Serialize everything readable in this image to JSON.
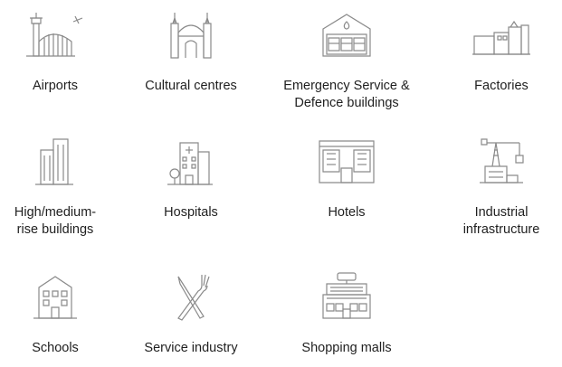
{
  "categories": [
    {
      "label": "Airports",
      "icon": "airport-icon"
    },
    {
      "label": "Cultural centres",
      "icon": "cultural-centre-icon"
    },
    {
      "label": "Emergency Service &\nDefence buildings",
      "icon": "fire-station-icon"
    },
    {
      "label": "Factories",
      "icon": "factory-icon"
    },
    {
      "label": "High/medium-\nrise buildings",
      "icon": "high-rise-icon"
    },
    {
      "label": "Hospitals",
      "icon": "hospital-icon"
    },
    {
      "label": "Hotels",
      "icon": "hotel-icon"
    },
    {
      "label": "Industrial\ninfrastructure",
      "icon": "industrial-crane-icon"
    },
    {
      "label": "Schools",
      "icon": "school-icon"
    },
    {
      "label": "Service industry",
      "icon": "fork-knife-icon"
    },
    {
      "label": "Shopping malls",
      "icon": "shopping-mall-icon"
    }
  ],
  "colors": {
    "icon_stroke": "#8a8a8a",
    "text": "#1f1f1f",
    "accent": "#e04a2f"
  }
}
